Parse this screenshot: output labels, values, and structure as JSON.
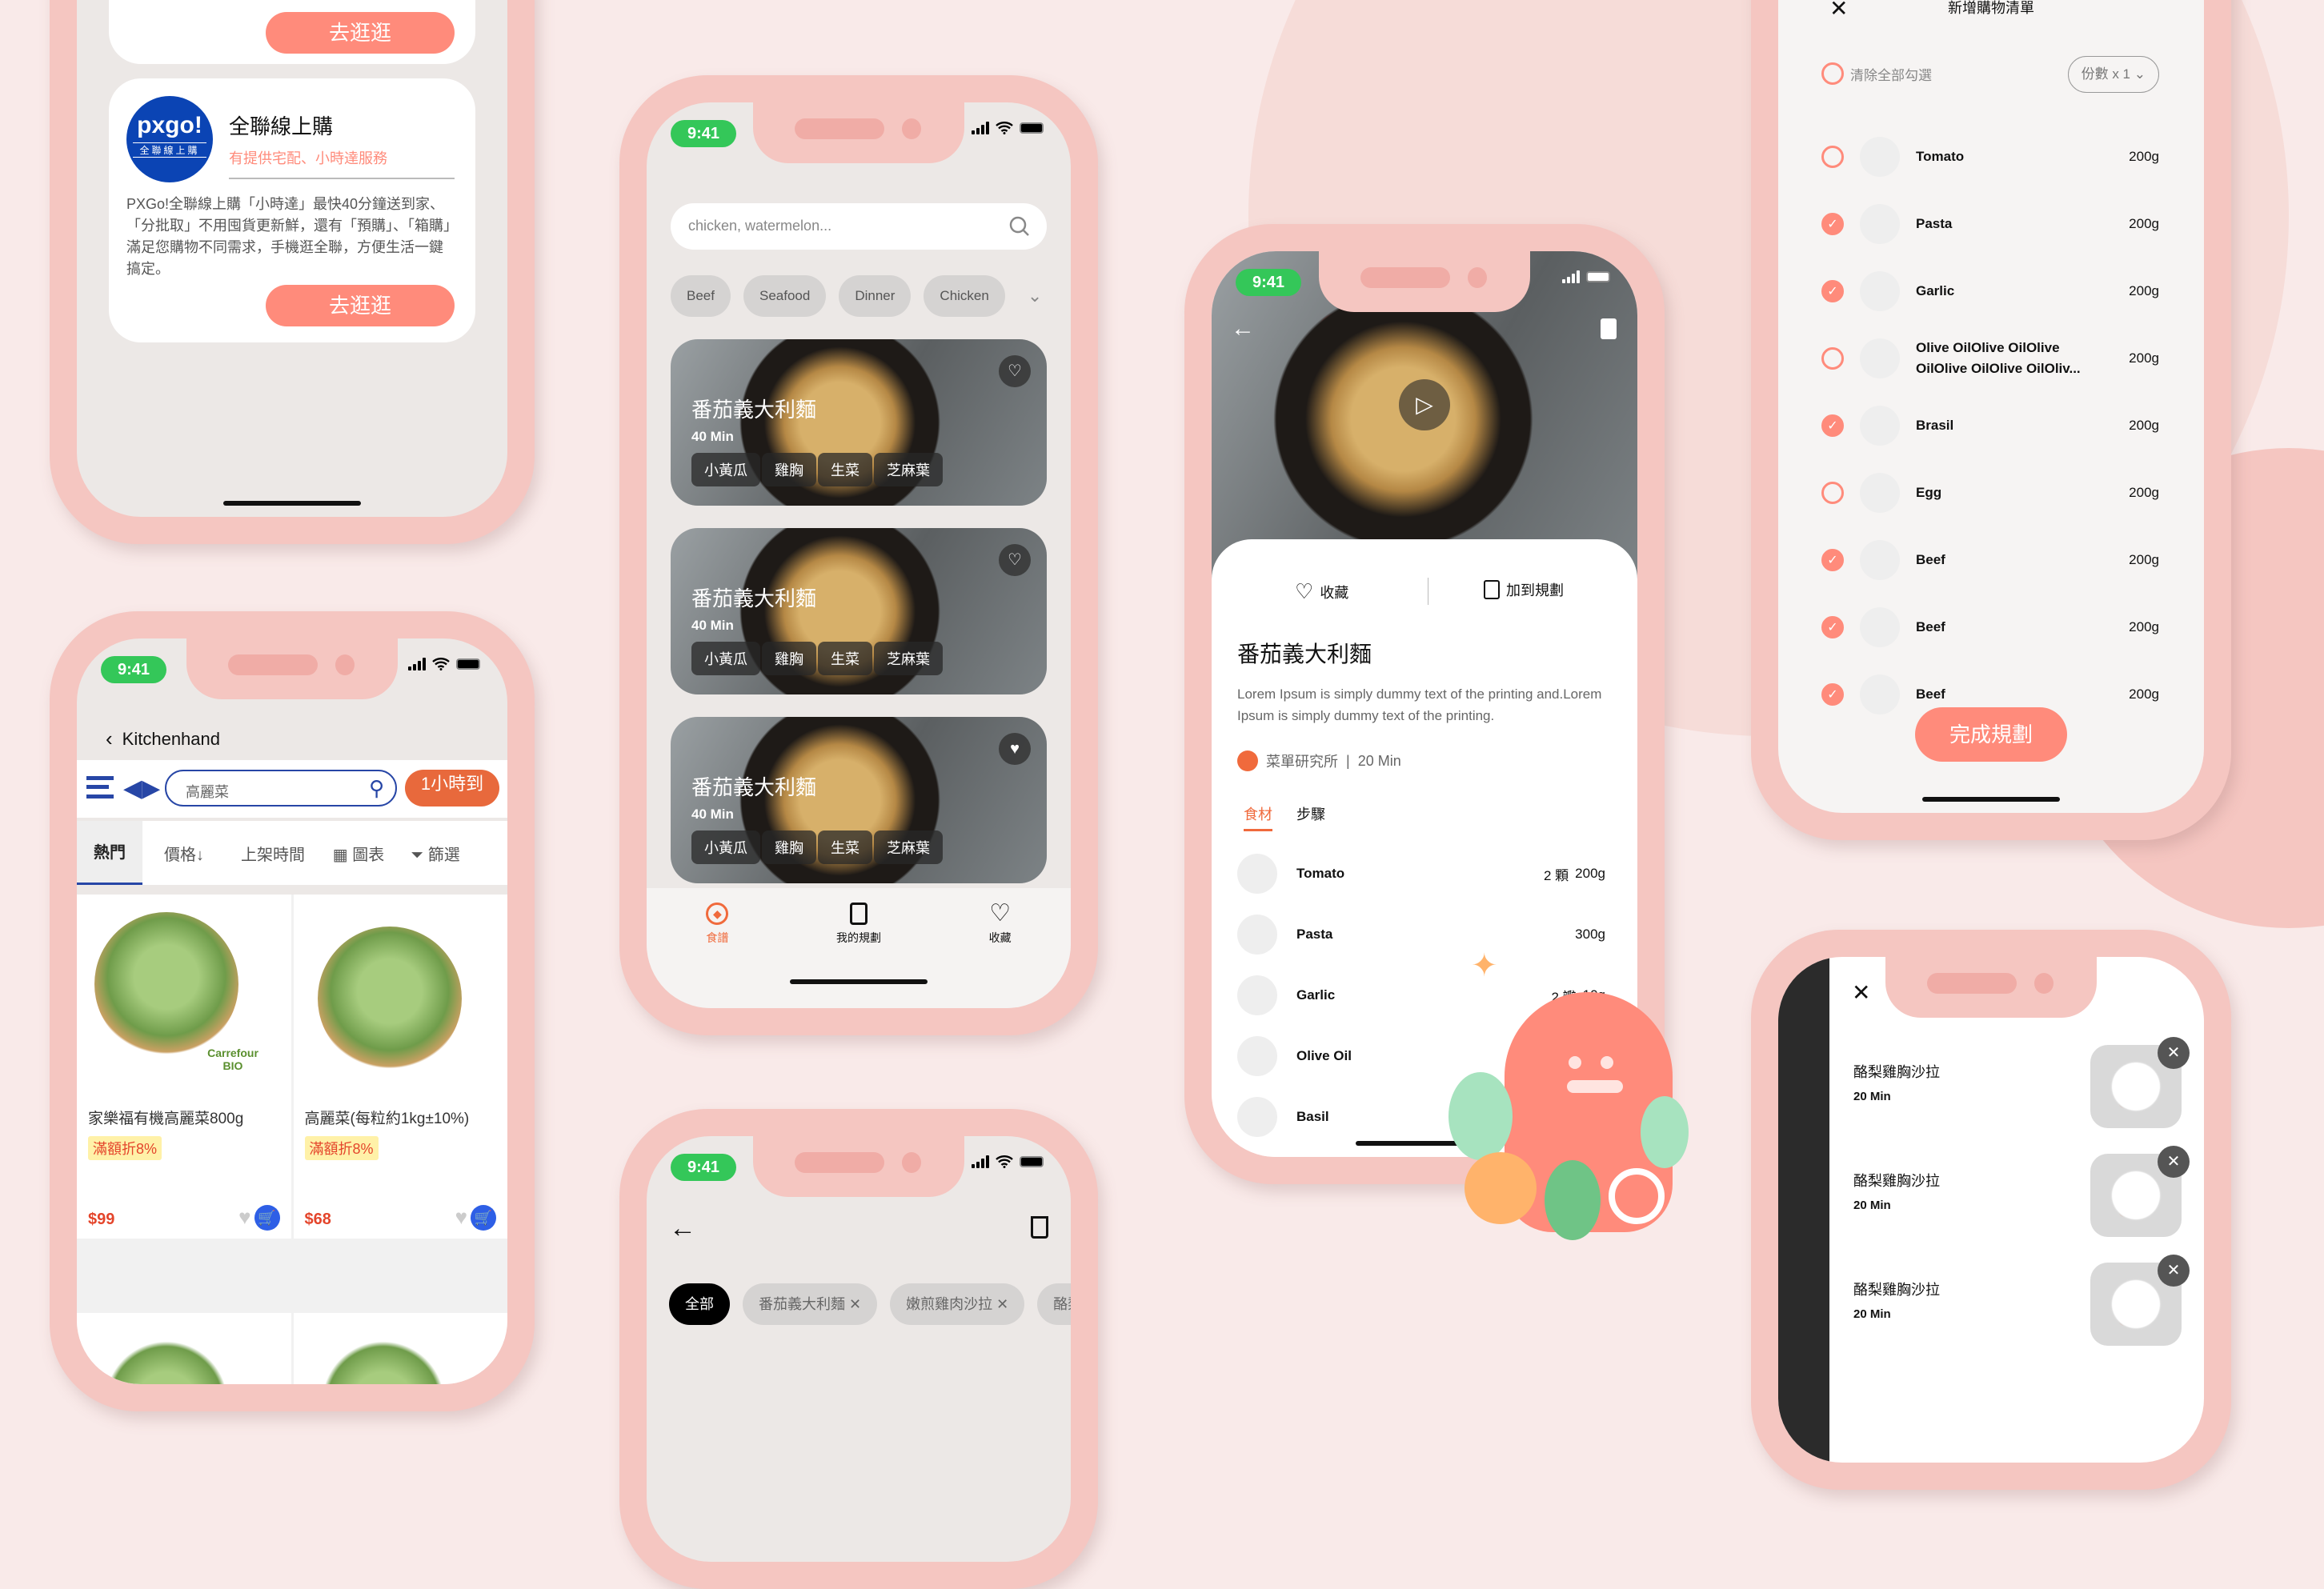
{
  "status_time": "9:41",
  "store_phone": {
    "top_button": "去逛逛",
    "store": {
      "logo_text": "pxgo!",
      "logo_sub": "全聯線上購",
      "name": "全聯線上購",
      "tagline": "有提供宅配、小時達服務",
      "description": "PXGo!全聯線上購「小時達」最快40分鐘送到家、「分批取」不用囤貨更新鮮，還有「預購」、「箱購」滿足您購物不同需求，手機逛全聯，方便生活一鍵搞定。",
      "button": "去逛逛"
    }
  },
  "carrefour_phone": {
    "back_label": "Kitchenhand",
    "search_value": "高麗菜",
    "badge": "1小時到",
    "sort_tabs": [
      "熱門",
      "價格↓",
      "上架時間",
      "圖表",
      "篩選"
    ],
    "products": [
      {
        "name": "家樂福有機高麗菜800g",
        "promo": "滿額折8%",
        "price": "$99",
        "brand": "Carrefour BIO"
      },
      {
        "name": "高麗菜(每粒約1kg±10%)",
        "promo": "滿額折8%",
        "price": "$68"
      }
    ]
  },
  "recipes_phone": {
    "search_placeholder": "chicken, watermelon...",
    "categories": [
      "Beef",
      "Seafood",
      "Dinner",
      "Chicken"
    ],
    "cards": [
      {
        "title": "番茄義大利麵",
        "time": "40 Min",
        "tags": [
          "小黃瓜",
          "雞胸",
          "生菜",
          "芝麻葉"
        ],
        "favorited": false
      },
      {
        "title": "番茄義大利麵",
        "time": "40 Min",
        "tags": [
          "小黃瓜",
          "雞胸",
          "生菜",
          "芝麻葉"
        ],
        "favorited": false
      },
      {
        "title": "番茄義大利麵",
        "time": "40 Min",
        "tags": [
          "小黃瓜",
          "雞胸",
          "生菜",
          "芝麻葉"
        ],
        "favorited": true
      }
    ],
    "nav": [
      {
        "label": "食譜",
        "icon": "compass-icon",
        "active": true
      },
      {
        "label": "我的規劃",
        "icon": "document-icon",
        "active": false
      },
      {
        "label": "收藏",
        "icon": "heart-icon",
        "active": false
      }
    ]
  },
  "plan_phone": {
    "filters": [
      "全部",
      "番茄義大利麵",
      "嫩煎雞肉沙拉",
      "酪梨"
    ]
  },
  "detail_phone": {
    "favorite_label": "收藏",
    "add_plan_label": "加到規劃",
    "title": "番茄義大利麵",
    "description": "Lorem Ipsum is simply dummy text of the printing and.Lorem Ipsum is simply dummy text of the printing.",
    "author": "菜單研究所",
    "time": "20 Min",
    "tabs": [
      "食材",
      "步驟"
    ],
    "ingredients": [
      {
        "name": "Tomato",
        "qty": "2 顆",
        "weight": "200g"
      },
      {
        "name": "Pasta",
        "qty": "",
        "weight": "300g"
      },
      {
        "name": "Garlic",
        "qty": "2 瓣",
        "weight": "10g"
      },
      {
        "name": "Olive Oil",
        "qty": "",
        "weight": ""
      },
      {
        "name": "Basil",
        "qty": "",
        "weight": ""
      }
    ]
  },
  "shopping_phone": {
    "title": "新增購物清單",
    "clear_all": "清除全部勾選",
    "servings": "份數 x 1",
    "items": [
      {
        "name": "Tomato",
        "weight": "200g",
        "checked": false
      },
      {
        "name": "Pasta",
        "weight": "200g",
        "checked": true
      },
      {
        "name": "Garlic",
        "weight": "200g",
        "checked": true
      },
      {
        "name": "Olive OilOlive OilOlive OilOlive OilOlive OilOliv...",
        "weight": "200g",
        "checked": false
      },
      {
        "name": "Brasil",
        "weight": "200g",
        "checked": true
      },
      {
        "name": "Egg",
        "weight": "200g",
        "checked": false
      },
      {
        "name": "Beef",
        "weight": "200g",
        "checked": true
      },
      {
        "name": "Beef",
        "weight": "200g",
        "checked": true
      },
      {
        "name": "Beef",
        "weight": "200g",
        "checked": true
      }
    ],
    "done_button": "完成規劃"
  },
  "saved_phone": {
    "items": [
      {
        "name": "酪梨雞胸沙拉",
        "time": "20 Min"
      },
      {
        "name": "酪梨雞胸沙拉",
        "time": "20 Min"
      },
      {
        "name": "酪梨雞胸沙拉",
        "time": "20 Min"
      }
    ]
  },
  "colors": {
    "accent": "#ff8b7b",
    "brand_orange": "#f06a3c",
    "status_green": "#34c759",
    "frame": "#f5c6c1"
  }
}
